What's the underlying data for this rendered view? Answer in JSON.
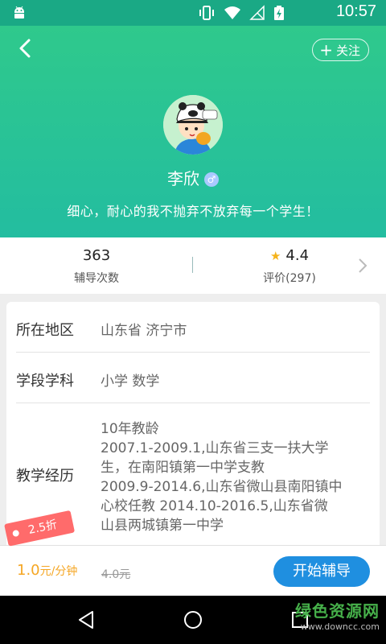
{
  "status_bar": {
    "time": "10:57"
  },
  "header": {
    "follow_label": "关注",
    "name": "李欣",
    "gender_symbol": "♂",
    "motto": "细心，耐心的我不抛弃不放弃每一个学生！"
  },
  "stats": {
    "sessions_count": "363",
    "sessions_label": "辅导次数",
    "rating": "4.4",
    "rating_label": "评价(297)"
  },
  "info": {
    "region_label": "所在地区",
    "region_value": "山东省 济宁市",
    "subject_label": "学段学科",
    "subject_value": "小学 数学",
    "experience_label": "教学经历",
    "experience_lines": [
      "10年教龄",
      "2007.1-2009.1,山东省三支一扶大学",
      "生，在南阳镇第一中学支教",
      "2009.9-2014.6,山东省微山县南阳镇中",
      "心校任教   2014.10-2016.5,山东省微",
      "山县两城镇第一中学"
    ]
  },
  "bottom": {
    "discount": "2.5折",
    "price": "1.0",
    "price_unit": "元/分钟",
    "original_price": "4.0元",
    "start_label": "开始辅导"
  },
  "watermark": {
    "title": "绿色资源网",
    "url": "www.downcc.com"
  },
  "colors": {
    "header_top": "#2fc98c",
    "header_bottom": "#23bda0",
    "accent_blue": "#1f8fe0",
    "price_orange": "#f5a623",
    "discount_red": "#ff6b6b"
  }
}
